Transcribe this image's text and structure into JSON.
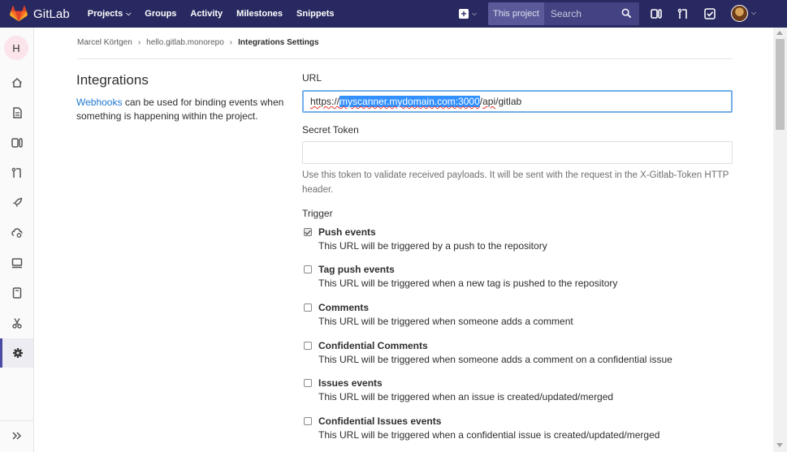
{
  "navbar": {
    "brand": "GitLab",
    "links": [
      {
        "label": "Projects",
        "has_dropdown": true
      },
      {
        "label": "Groups",
        "has_dropdown": false
      },
      {
        "label": "Activity",
        "has_dropdown": false
      },
      {
        "label": "Milestones",
        "has_dropdown": false
      },
      {
        "label": "Snippets",
        "has_dropdown": false
      }
    ],
    "search": {
      "scope": "This project",
      "placeholder": "Search"
    },
    "icons": [
      "plus-icon",
      "issues-icon",
      "merge-request-icon",
      "todo-icon",
      "user-avatar"
    ],
    "colors": {
      "navbar_bg": "#292961",
      "accent": "#fc6d26"
    }
  },
  "sidebar": {
    "project_initial": "H",
    "items": [
      "home-icon",
      "repository-icon",
      "issues-icon",
      "merge-requests-icon",
      "ci-cd-icon",
      "operations-icon",
      "environments-icon",
      "wiki-icon",
      "snippets-icon",
      "settings-icon"
    ],
    "active": "settings-icon"
  },
  "breadcrumb": {
    "user": "Marcel Körtgen",
    "project": "hello.gitlab.monorepo",
    "current": "Integrations Settings"
  },
  "integrations": {
    "title": "Integrations",
    "desc_link": "Webhooks",
    "desc_rest": " can be used for binding events when something is happening within the project."
  },
  "form": {
    "url_label": "URL",
    "url_prefix": "https://",
    "url_selected": "myscanner.mydomain.com:3000",
    "url_slash": "/",
    "url_api": "api",
    "url_tail": "/",
    "url_gitlab": "gitlab",
    "token_label": "Secret Token",
    "token_value": "",
    "token_help": "Use this token to validate received payloads. It will be sent with the request in the X-Gitlab-Token HTTP header.",
    "trigger_label": "Trigger",
    "triggers": [
      {
        "title": "Push events",
        "desc": "This URL will be triggered by a push to the repository",
        "checked": true
      },
      {
        "title": "Tag push events",
        "desc": "This URL will be triggered when a new tag is pushed to the repository",
        "checked": false
      },
      {
        "title": "Comments",
        "desc": "This URL will be triggered when someone adds a comment",
        "checked": false
      },
      {
        "title": "Confidential Comments",
        "desc": "This URL will be triggered when someone adds a comment on a confidential issue",
        "checked": false
      },
      {
        "title": "Issues events",
        "desc": "This URL will be triggered when an issue is created/updated/merged",
        "checked": false
      },
      {
        "title": "Confidential Issues events",
        "desc": "This URL will be triggered when a confidential issue is created/updated/merged",
        "checked": false
      }
    ]
  }
}
